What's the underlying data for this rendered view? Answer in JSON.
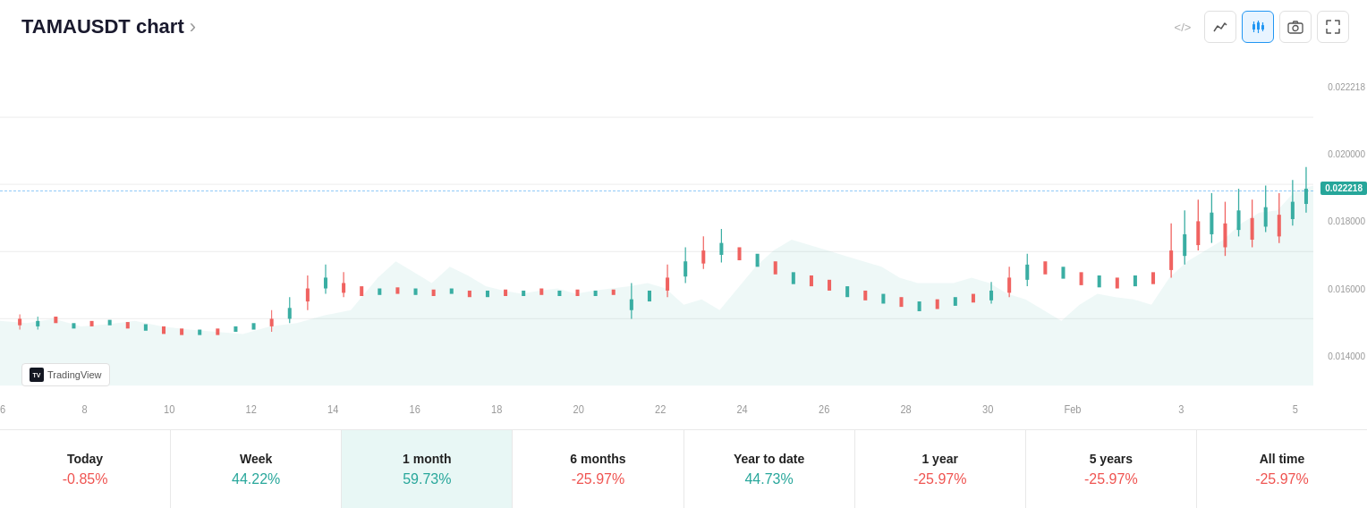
{
  "header": {
    "title": "TAMAUSDT chart",
    "title_arrow": "›",
    "embed_label": "</>"
  },
  "toolbar": {
    "line_icon": "line-chart",
    "candle_icon": "candle-chart",
    "camera_icon": "camera",
    "fullscreen_icon": "fullscreen",
    "active_button": "candle"
  },
  "chart": {
    "current_price": "0.022218",
    "dashed_line_top_pct": 37,
    "price_badge_top_pct": 37,
    "y_labels": [
      "0.022218",
      "0.020000",
      "0.018000",
      "0.016000",
      "0.014000"
    ],
    "x_labels": [
      "6",
      "8",
      "10",
      "12",
      "14",
      "16",
      "18",
      "20",
      "22",
      "24",
      "26",
      "28",
      "30",
      "Feb",
      "3",
      "5"
    ]
  },
  "tradingview": {
    "label": "TradingView"
  },
  "periods": [
    {
      "label": "Today",
      "value": "-0.85%",
      "type": "negative",
      "active": false
    },
    {
      "label": "Week",
      "value": "44.22%",
      "type": "positive",
      "active": false
    },
    {
      "label": "1 month",
      "value": "59.73%",
      "type": "positive",
      "active": true
    },
    {
      "label": "6 months",
      "value": "-25.97%",
      "type": "negative",
      "active": false
    },
    {
      "label": "Year to date",
      "value": "44.73%",
      "type": "positive",
      "active": false
    },
    {
      "label": "1 year",
      "value": "-25.97%",
      "type": "negative",
      "active": false
    },
    {
      "label": "5 years",
      "value": "-25.97%",
      "type": "negative",
      "active": false
    },
    {
      "label": "All time",
      "value": "-25.97%",
      "type": "negative",
      "active": false
    }
  ]
}
